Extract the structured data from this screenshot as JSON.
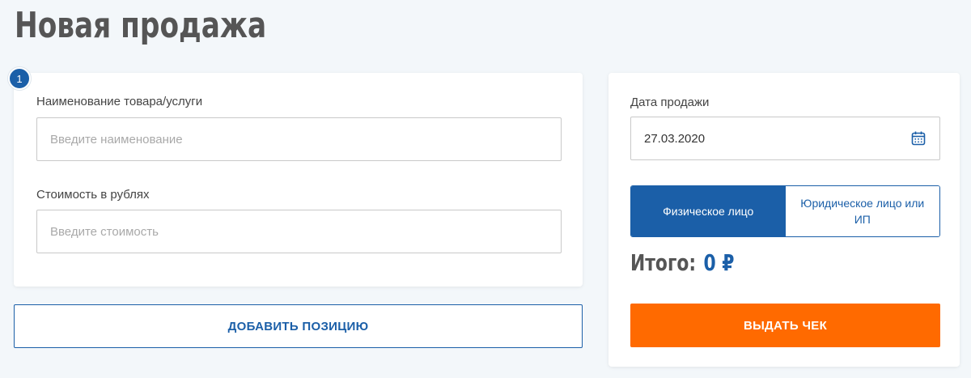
{
  "page": {
    "title": "Новая продажа"
  },
  "form": {
    "step_number": "1",
    "name_label": "Наименование товара/услуги",
    "name_placeholder": "Введите наименование",
    "name_value": "",
    "price_label": "Стоимость в рублях",
    "price_placeholder": "Введите стоимость",
    "price_value": "",
    "add_button_label": "ДОБАВИТЬ ПОЗИЦИЮ"
  },
  "sidebar": {
    "date_label": "Дата продажи",
    "date_value": "27.03.2020",
    "date_icon": "calendar-icon",
    "buyer_type": {
      "options": [
        "Физическое лицо",
        "Юридическое лицо или ИП"
      ],
      "selected": "Физическое лицо"
    },
    "total_label": "Итого:",
    "total_value": "0 ₽",
    "issue_button_label": "ВЫДАТЬ ЧЕК"
  },
  "colors": {
    "accent": "#1b5fa8",
    "primary_action": "#ff6a00",
    "background": "#f3f7fa"
  }
}
